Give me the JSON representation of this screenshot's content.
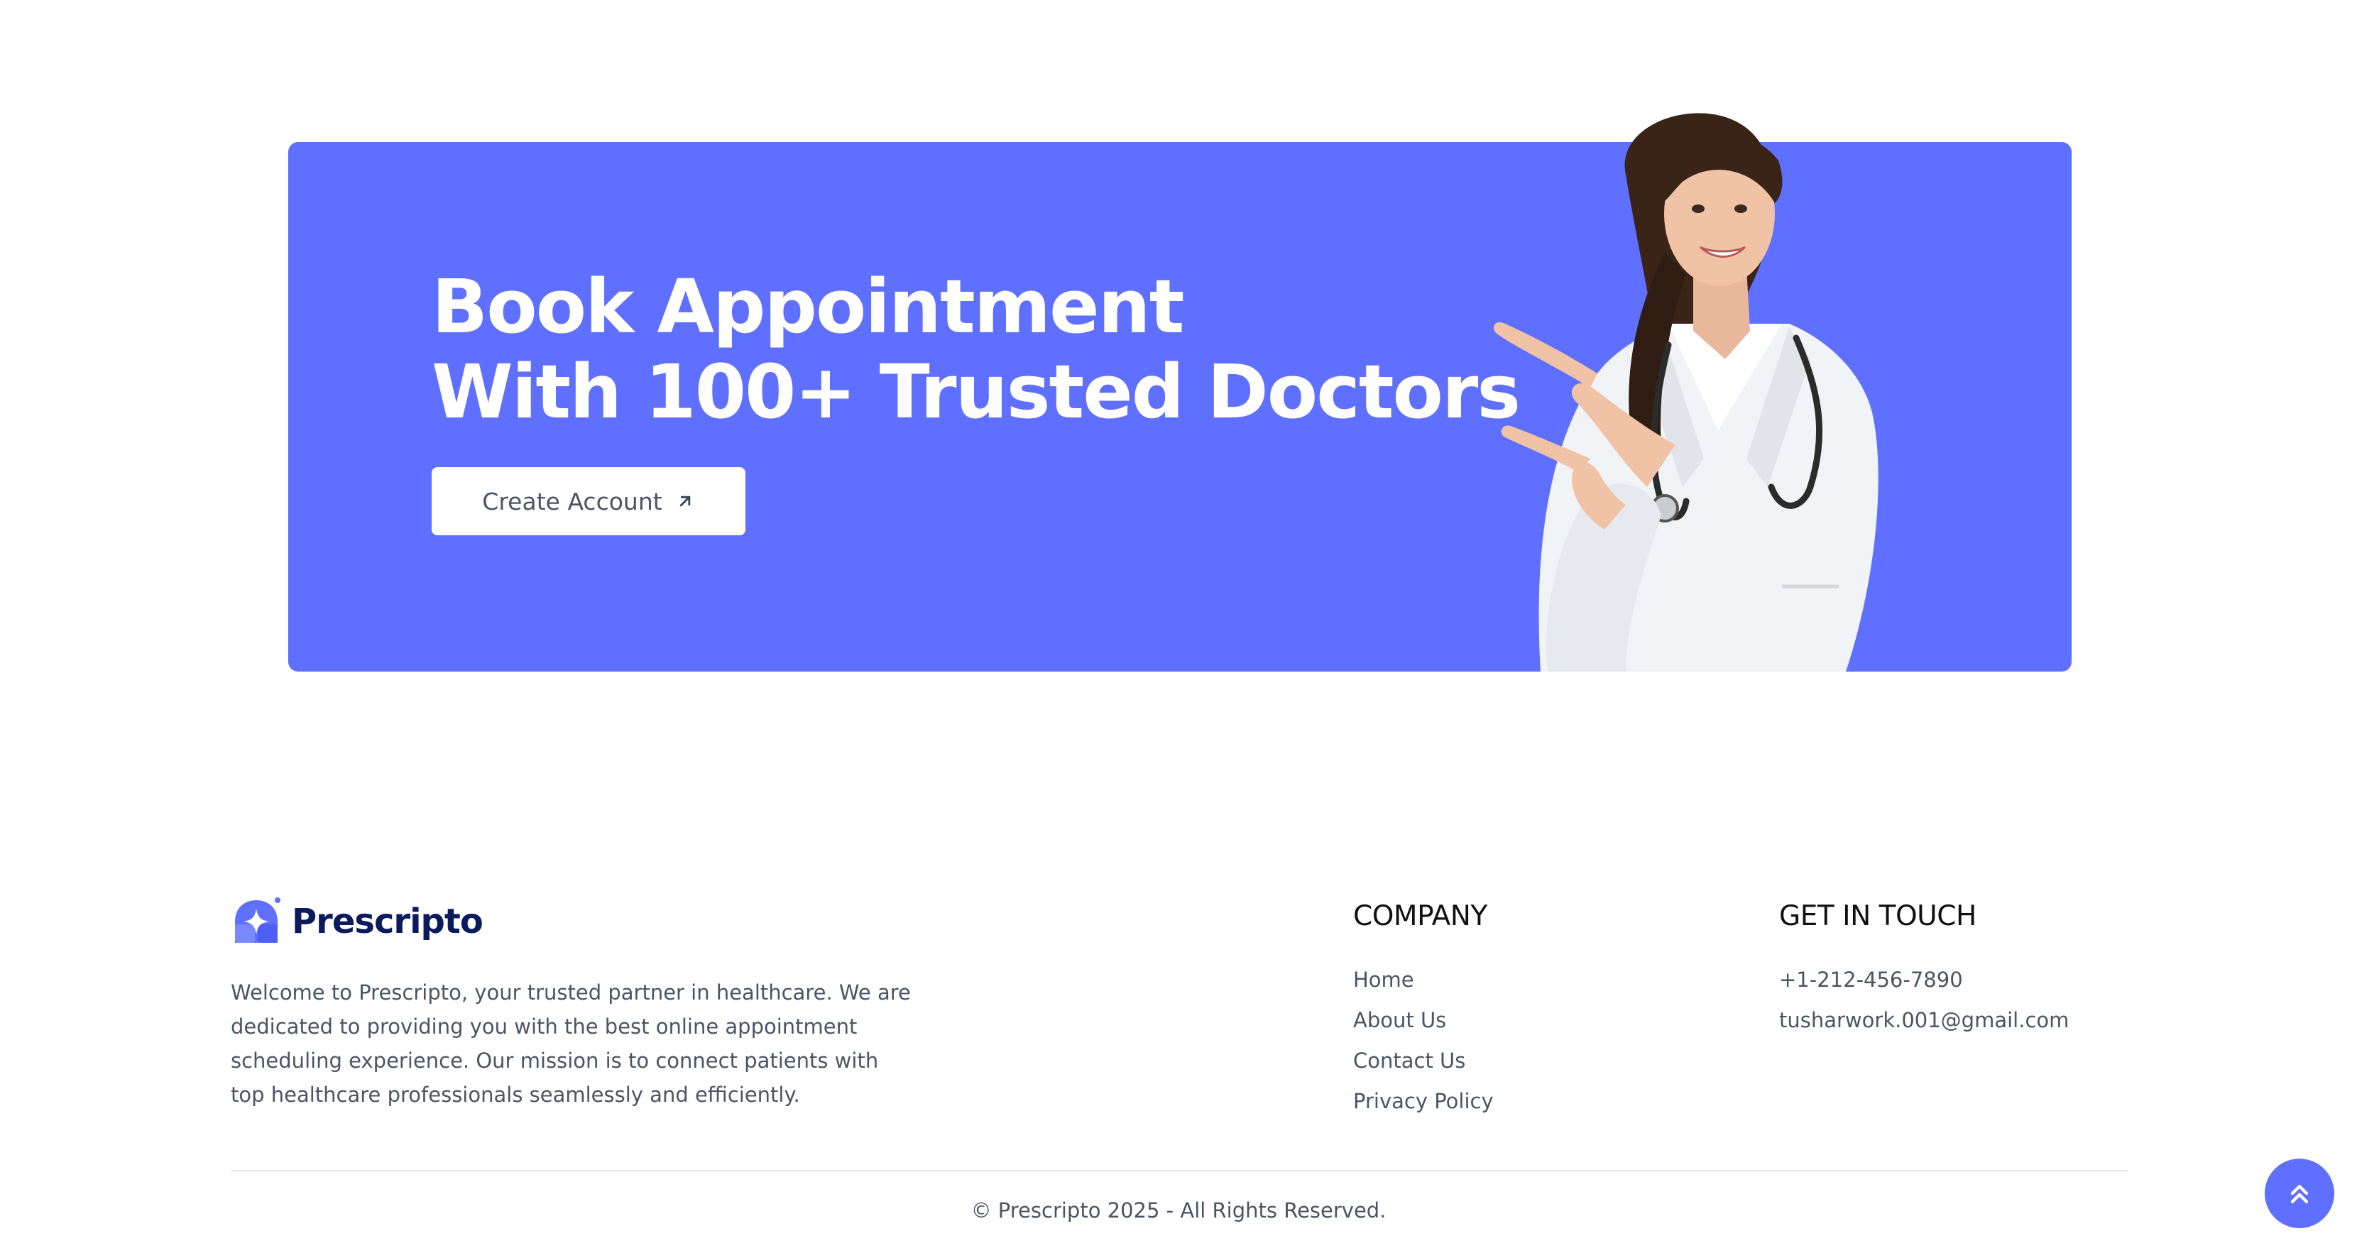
{
  "banner": {
    "title_line1": "Book Appointment",
    "title_line2": "With 100+ Trusted Doctors",
    "cta_label": "Create Account",
    "cta_icon": "arrow-up-right-icon",
    "background_color": "#5f6fff",
    "image": "doctor-pointing-illustration"
  },
  "footer": {
    "brand": {
      "name": "Prescripto",
      "icon": "prescripto-logo-icon"
    },
    "about": "Welcome to Prescripto, your trusted partner in healthcare. We are dedicated to providing you with the best online appointment scheduling experience. Our mission is to connect patients with top healthcare professionals seamlessly and efficiently.",
    "company": {
      "heading": "COMPANY",
      "links": [
        "Home",
        "About Us",
        "Contact Us",
        "Privacy Policy"
      ]
    },
    "contact": {
      "heading": "GET IN TOUCH",
      "phone": "+1-212-456-7890",
      "email": "tusharwork.001@gmail.com"
    },
    "copyright": "© Prescripto 2025 - All Rights Reserved."
  },
  "scroll_top": {
    "icon": "double-chevron-up-icon"
  },
  "colors": {
    "accent": "#5f6fff",
    "brand_text": "#0b1a5c",
    "body_text": "#4b5563"
  }
}
